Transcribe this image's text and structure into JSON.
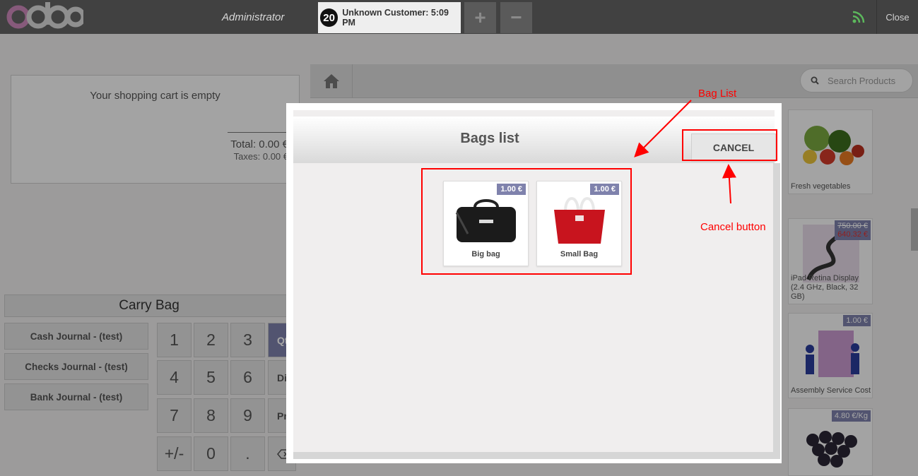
{
  "topbar": {
    "logo_text": "odoo",
    "user": "Administrator",
    "order_number": "20",
    "order_label": "Unknown Customer: 5:09 PM",
    "add_label": "+",
    "remove_label": "−",
    "close_label": "Close"
  },
  "cart": {
    "empty_text": "Your shopping cart is empty",
    "total": "Total: 0.00 €",
    "taxes": "Taxes: 0.00 €"
  },
  "carry_bag_label": "Carry Bag",
  "journals": [
    "Cash Journal - (test)",
    "Checks Journal - (test)",
    "Bank Journal - (test)"
  ],
  "numpad": {
    "keys": [
      "1",
      "2",
      "3",
      "4",
      "5",
      "6",
      "7",
      "8",
      "9",
      "+/-",
      "0",
      "."
    ],
    "modes": [
      "Qty",
      "Disc",
      "Price"
    ]
  },
  "products_pane": {
    "search_placeholder": "Search Products",
    "products": [
      {
        "name": "Fresh vegetables"
      },
      {
        "name": "iPad Retina Display (2.4 GHz, Black, 32 GB)",
        "old_price": "750.00 €",
        "price": "640.32 €"
      },
      {
        "name": "Assembly Service Cost",
        "price": "1.00 €"
      },
      {
        "name": "",
        "price": "4.80 €/Kg"
      }
    ]
  },
  "modal": {
    "title": "Bags list",
    "cancel_label": "CANCEL",
    "bags": [
      {
        "name": "Big bag",
        "price": "1.00 €"
      },
      {
        "name": "Small Bag",
        "price": "1.00 €"
      }
    ]
  },
  "annotations": {
    "bag_list_label": "Bag List",
    "cancel_button_label": "Cancel button",
    "color": "#ff0000"
  }
}
